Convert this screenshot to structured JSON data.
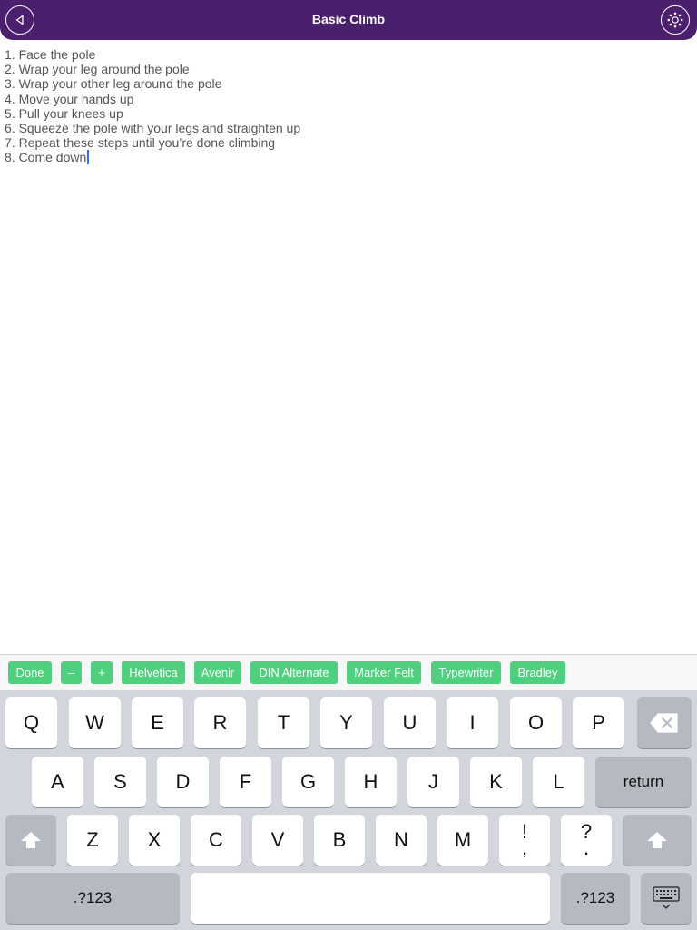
{
  "header": {
    "title": "Basic Climb",
    "bg_color": "#4a1f6e",
    "back_icon": "back-triangle-icon",
    "settings_icon": "gear-icon"
  },
  "note": {
    "lines": [
      "1. Face the pole",
      "2. Wrap your leg around the pole",
      "3. Wrap your other leg around the pole",
      "4. Move your hands up",
      "5. Pull your knees up",
      "6. Squeeze the pole with your legs and straighten up",
      "7. Repeat these steps until you’re done climbing",
      "8. Come down"
    ]
  },
  "toolbar": {
    "chip_color": "#4fd07e",
    "done": "Done",
    "minus": "–",
    "plus": "+",
    "fonts": [
      "Helvetica",
      "Avenir",
      "DIN Alternate",
      "Marker Felt",
      "Typewriter",
      "Bradley"
    ]
  },
  "keyboard": {
    "row1": [
      "Q",
      "W",
      "E",
      "R",
      "T",
      "Y",
      "U",
      "I",
      "O",
      "P"
    ],
    "row2": [
      "A",
      "S",
      "D",
      "F",
      "G",
      "H",
      "J",
      "K",
      "L"
    ],
    "return": "return",
    "row3": [
      "Z",
      "X",
      "C",
      "V",
      "B",
      "N",
      "M"
    ],
    "punct1_top": "!",
    "punct1_bottom": ",",
    "punct2_top": "?",
    "punct2_bottom": ".",
    "numbers": ".?123",
    "numbers_right": ".?123"
  }
}
